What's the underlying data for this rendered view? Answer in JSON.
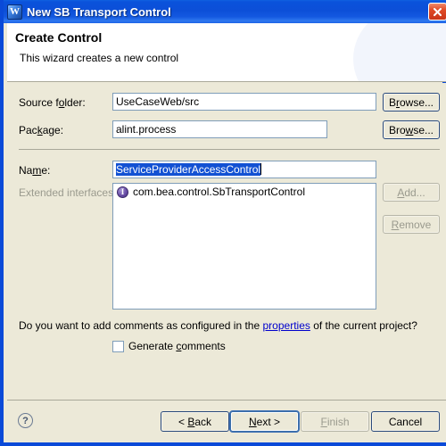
{
  "window": {
    "title": "New SB Transport Control",
    "icon": "workshop-w-icon",
    "icon_letter": "W",
    "close_label": "Close",
    "titlebar_color": "#0a4ad8"
  },
  "header": {
    "title": "Create Control",
    "subtitle": "This wizard creates a new control"
  },
  "form": {
    "source_folder": {
      "label_pre": "Source f",
      "label_mn": "o",
      "label_post": "lder:",
      "value": "UseCaseWeb/src",
      "browse_pre": "B",
      "browse_mn": "r",
      "browse_post": "owse..."
    },
    "package": {
      "label_pre": "Pac",
      "label_mn": "k",
      "label_post": "age:",
      "value": "alint.process",
      "browse_pre": "Bro",
      "browse_mn": "w",
      "browse_post": "se..."
    },
    "name": {
      "label_pre": "Na",
      "label_mn": "m",
      "label_post": "e:",
      "value": "ServiceProviderAccessControl",
      "selected": true
    },
    "extended_interfaces": {
      "label": "Extended interfaces:",
      "disabled": true,
      "items": [
        {
          "icon": "interface-icon",
          "icon_letter": "I",
          "text": "com.bea.control.SbTransportControl"
        }
      ],
      "add_pre": "",
      "add_mn": "A",
      "add_post": "dd...",
      "add_disabled": true,
      "remove_pre": "",
      "remove_mn": "R",
      "remove_post": "emove",
      "remove_disabled": true
    }
  },
  "comments": {
    "question_pre": "Do you want to add comments as configured in the ",
    "question_link": "properties",
    "question_post": " of the current project?",
    "checkbox_pre": "Generate ",
    "checkbox_mn": "c",
    "checkbox_post": "omments",
    "checkbox_checked": false
  },
  "footer": {
    "help_icon": "help-question-icon",
    "help_glyph": "?",
    "buttons": [
      {
        "name": "back",
        "pre": "< ",
        "mn": "B",
        "post": "ack",
        "disabled": false,
        "default": false
      },
      {
        "name": "next",
        "pre": "",
        "mn": "N",
        "post": "ext >",
        "disabled": false,
        "default": true
      },
      {
        "name": "finish",
        "pre": "",
        "mn": "F",
        "post": "inish",
        "disabled": true,
        "default": false
      },
      {
        "name": "cancel",
        "pre": "Cancel",
        "mn": "",
        "post": "",
        "disabled": false,
        "default": false
      }
    ]
  }
}
